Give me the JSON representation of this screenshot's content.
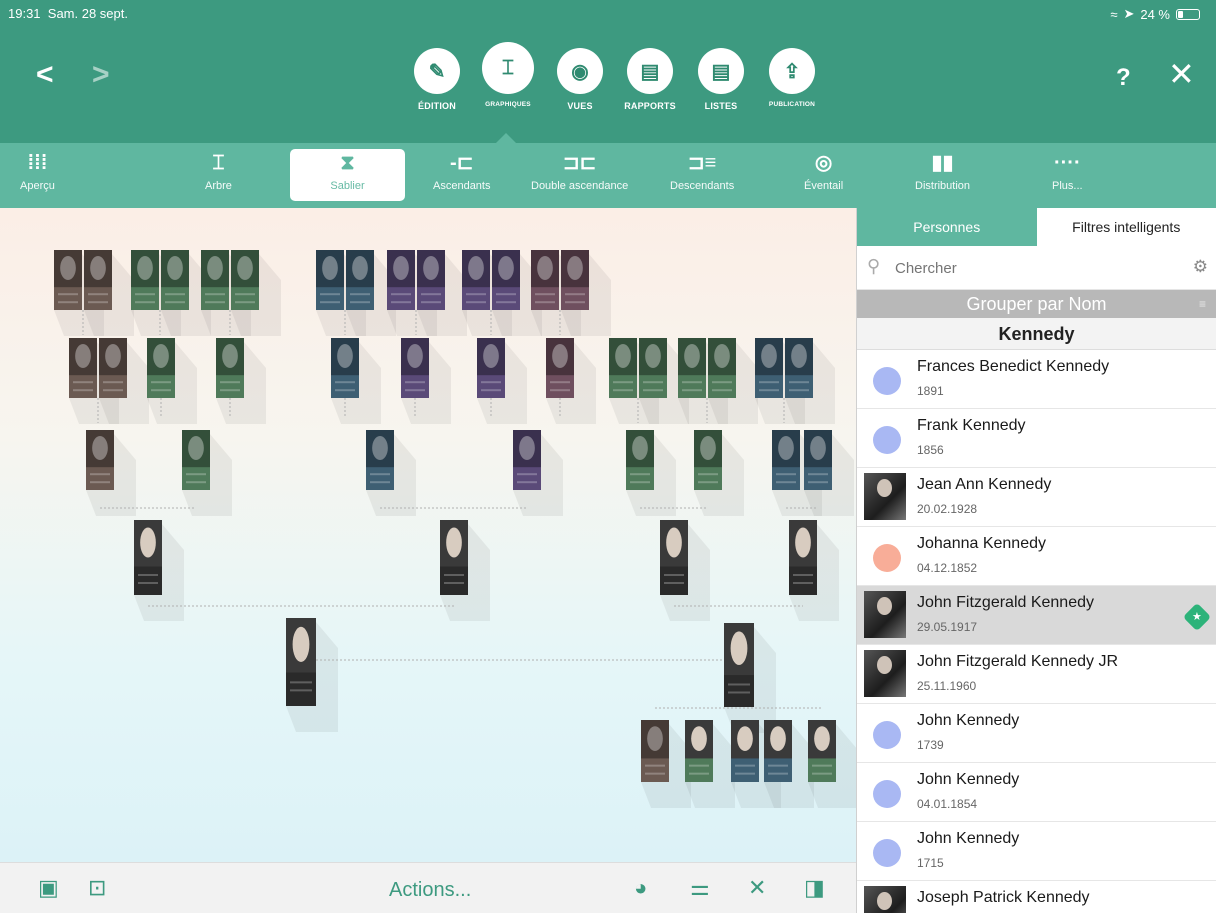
{
  "status": {
    "time": "19:31",
    "date": "Sam. 28 sept.",
    "battery": "24 %"
  },
  "nav": {
    "back": "<",
    "forward": ">",
    "help": "?",
    "close": "✕"
  },
  "modes": [
    {
      "label": "ÉDITION",
      "icon": "edit-pencil-icon",
      "glyph": "✎"
    },
    {
      "label": "GRAPHIQUES",
      "icon": "graph-icon",
      "glyph": "⌶"
    },
    {
      "label": "VUES",
      "icon": "eye-icon",
      "glyph": "◉"
    },
    {
      "label": "RAPPORTS",
      "icon": "report-icon",
      "glyph": "▤"
    },
    {
      "label": "LISTES",
      "icon": "list-icon",
      "glyph": "▤"
    },
    {
      "label": "PUBLICATION",
      "icon": "upload-icon",
      "glyph": "⇪"
    }
  ],
  "chart_types": [
    {
      "label": "Aperçu",
      "icon": "grid-icon",
      "glyph": "⁞⁞⁞"
    },
    {
      "label": "Arbre",
      "icon": "tree-icon",
      "glyph": "⌶"
    },
    {
      "label": "Sablier",
      "icon": "hourglass-icon",
      "glyph": "⧗"
    },
    {
      "label": "Ascendants",
      "icon": "ancestors-icon",
      "glyph": "-⊏"
    },
    {
      "label": "Double ascendance",
      "icon": "double-ancestry-icon",
      "glyph": "⊐⊏"
    },
    {
      "label": "Descendants",
      "icon": "descendants-icon",
      "glyph": "⊐≡"
    },
    {
      "label": "Éventail",
      "icon": "fan-icon",
      "glyph": "◎"
    },
    {
      "label": "Distribution",
      "icon": "distribution-icon",
      "glyph": "▮▮"
    },
    {
      "label": "Plus...",
      "icon": "more-icon",
      "glyph": "····"
    }
  ],
  "bottom": {
    "actions": "Actions...",
    "icons": [
      "fit-screen-icon",
      "focus-person-icon",
      "palette-icon",
      "toggle-icon",
      "tools-icon",
      "sidebar-icon"
    ]
  },
  "sidebar": {
    "tabs": [
      "Personnes",
      "Filtres intelligents"
    ],
    "search_placeholder": "Chercher",
    "group_label": "Grouper par Nom",
    "section": "Kennedy",
    "persons": [
      {
        "name": "Frances Benedict Kennedy",
        "date": "1891",
        "avatar": "#a9b8f3",
        "photo": false
      },
      {
        "name": "Frank Kennedy",
        "date": "1856",
        "avatar": "#a9b8f3",
        "photo": false
      },
      {
        "name": "Jean Ann Kennedy",
        "date": "20.02.1928",
        "avatar": "",
        "photo": true
      },
      {
        "name": "Johanna Kennedy",
        "date": "04.12.1852",
        "avatar": "#f8ad98",
        "photo": false
      },
      {
        "name": "John Fitzgerald Kennedy",
        "date": "29.05.1917",
        "avatar": "",
        "photo": true,
        "selected": true
      },
      {
        "name": "John Fitzgerald Kennedy JR",
        "date": "25.11.1960",
        "avatar": "",
        "photo": true
      },
      {
        "name": "John Kennedy",
        "date": "1739",
        "avatar": "#a9b8f3",
        "photo": false
      },
      {
        "name": "John Kennedy",
        "date": "04.01.1854",
        "avatar": "#a9b8f3",
        "photo": false
      },
      {
        "name": "John Kennedy",
        "date": "1715",
        "avatar": "#a9b8f3",
        "photo": false
      },
      {
        "name": "Joseph Patrick Kennedy",
        "date": "",
        "avatar": "",
        "photo": true
      }
    ]
  },
  "colors": {
    "primary": "#3d9a80",
    "secondary": "#5fb7a0",
    "card_dark": "#2a2a2a",
    "card_brown": "#6b5a52",
    "card_green": "#4f7a5a",
    "card_blue": "#3e5f73",
    "card_purple": "#5a4a78",
    "card_mauve": "#6f4f5f"
  }
}
